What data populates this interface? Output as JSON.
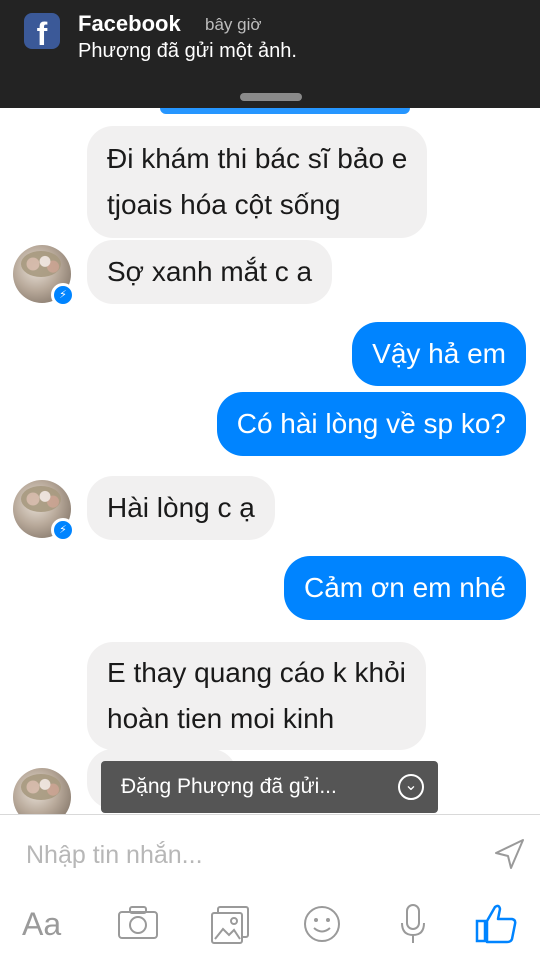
{
  "notification": {
    "app": "Facebook",
    "time": "bây giờ",
    "body": "Phượng đã gửi một ảnh.",
    "icon": "facebook-icon"
  },
  "messages": [
    "Đi khám thi bác sĩ bảo e",
    "tjoais hóa cột sống",
    "Sợ xanh mắt c a",
    "Vậy hả em",
    "Có hài lòng về sp ko?",
    "Hài lòng c ạ",
    "Cảm ơn em nhé",
    "E thay quang cáo k khỏi",
    "hoàn tien moi kinh"
  ],
  "toast": {
    "text": "Đặng Phượng đã gửi...",
    "icon": "chevron-down-icon"
  },
  "composer": {
    "placeholder": "Nhập tin nhắn...",
    "aa_label": "Aa"
  },
  "colors": {
    "outgoing": "#0084ff",
    "incoming": "#f1f0f0",
    "notification_bg": "#232323"
  }
}
